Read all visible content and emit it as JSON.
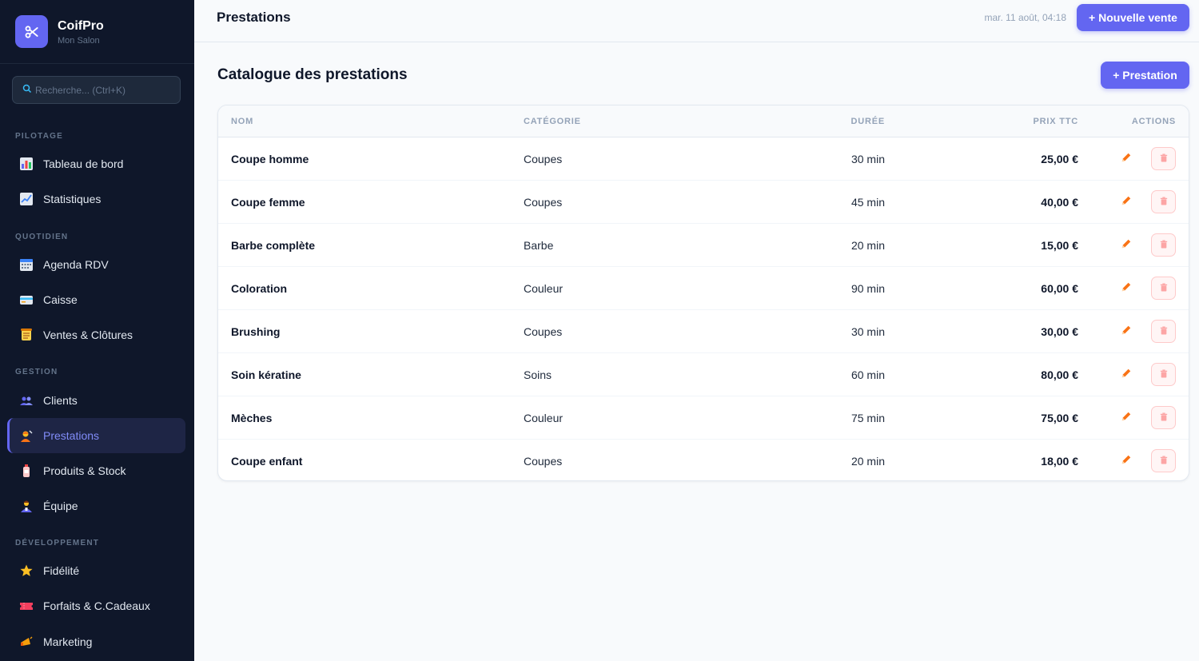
{
  "brand": {
    "name": "CoifPro",
    "subtitle": "Mon Salon",
    "logo_icon": "scissors-icon",
    "accent": "#6366f1"
  },
  "search": {
    "placeholder": "Recherche... (Ctrl+K)",
    "value": ""
  },
  "sidebar": {
    "sections": [
      {
        "title": "PILOTAGE",
        "items": [
          {
            "label": "Tableau de bord",
            "icon": "bar-chart-icon"
          },
          {
            "label": "Statistiques",
            "icon": "line-chart-icon"
          }
        ]
      },
      {
        "title": "QUOTIDIEN",
        "items": [
          {
            "label": "Agenda RDV",
            "icon": "calendar-icon"
          },
          {
            "label": "Caisse",
            "icon": "credit-card-icon"
          },
          {
            "label": "Ventes & Clôtures",
            "icon": "receipt-scroll-icon"
          }
        ]
      },
      {
        "title": "GESTION",
        "items": [
          {
            "label": "Clients",
            "icon": "users-icon"
          },
          {
            "label": "Prestations",
            "icon": "haircut-icon",
            "active": true
          },
          {
            "label": "Produits & Stock",
            "icon": "lotion-bottle-icon"
          },
          {
            "label": "Équipe",
            "icon": "team-member-icon"
          }
        ]
      },
      {
        "title": "DÉVELOPPEMENT",
        "items": [
          {
            "label": "Fidélité",
            "icon": "star-icon"
          },
          {
            "label": "Forfaits & C.Cadeaux",
            "icon": "ticket-icon"
          },
          {
            "label": "Marketing",
            "icon": "megaphone-icon"
          }
        ]
      }
    ]
  },
  "header": {
    "title": "Prestations",
    "datetime": "mar. 11 août, 04:18",
    "new_sale_label": "+ Nouvelle vente"
  },
  "catalog": {
    "title": "Catalogue des prestations",
    "add_label": "+ Prestation",
    "columns": {
      "name": "NOM",
      "category": "CATÉGORIE",
      "duration": "DURÉE",
      "price": "PRIX TTC",
      "actions": "ACTIONS"
    },
    "rows": [
      {
        "name": "Coupe homme",
        "category": "Coupes",
        "duration": "30 min",
        "price": "25,00 €"
      },
      {
        "name": "Coupe femme",
        "category": "Coupes",
        "duration": "45 min",
        "price": "40,00 €"
      },
      {
        "name": "Barbe complète",
        "category": "Barbe",
        "duration": "20 min",
        "price": "15,00 €"
      },
      {
        "name": "Coloration",
        "category": "Couleur",
        "duration": "90 min",
        "price": "60,00 €"
      },
      {
        "name": "Brushing",
        "category": "Coupes",
        "duration": "30 min",
        "price": "30,00 €"
      },
      {
        "name": "Soin kératine",
        "category": "Soins",
        "duration": "60 min",
        "price": "80,00 €"
      },
      {
        "name": "Mèches",
        "category": "Couleur",
        "duration": "75 min",
        "price": "75,00 €"
      },
      {
        "name": "Coupe enfant",
        "category": "Coupes",
        "duration": "20 min",
        "price": "18,00 €"
      }
    ],
    "edit_icon": "pencil-icon",
    "delete_icon": "trash-icon"
  }
}
